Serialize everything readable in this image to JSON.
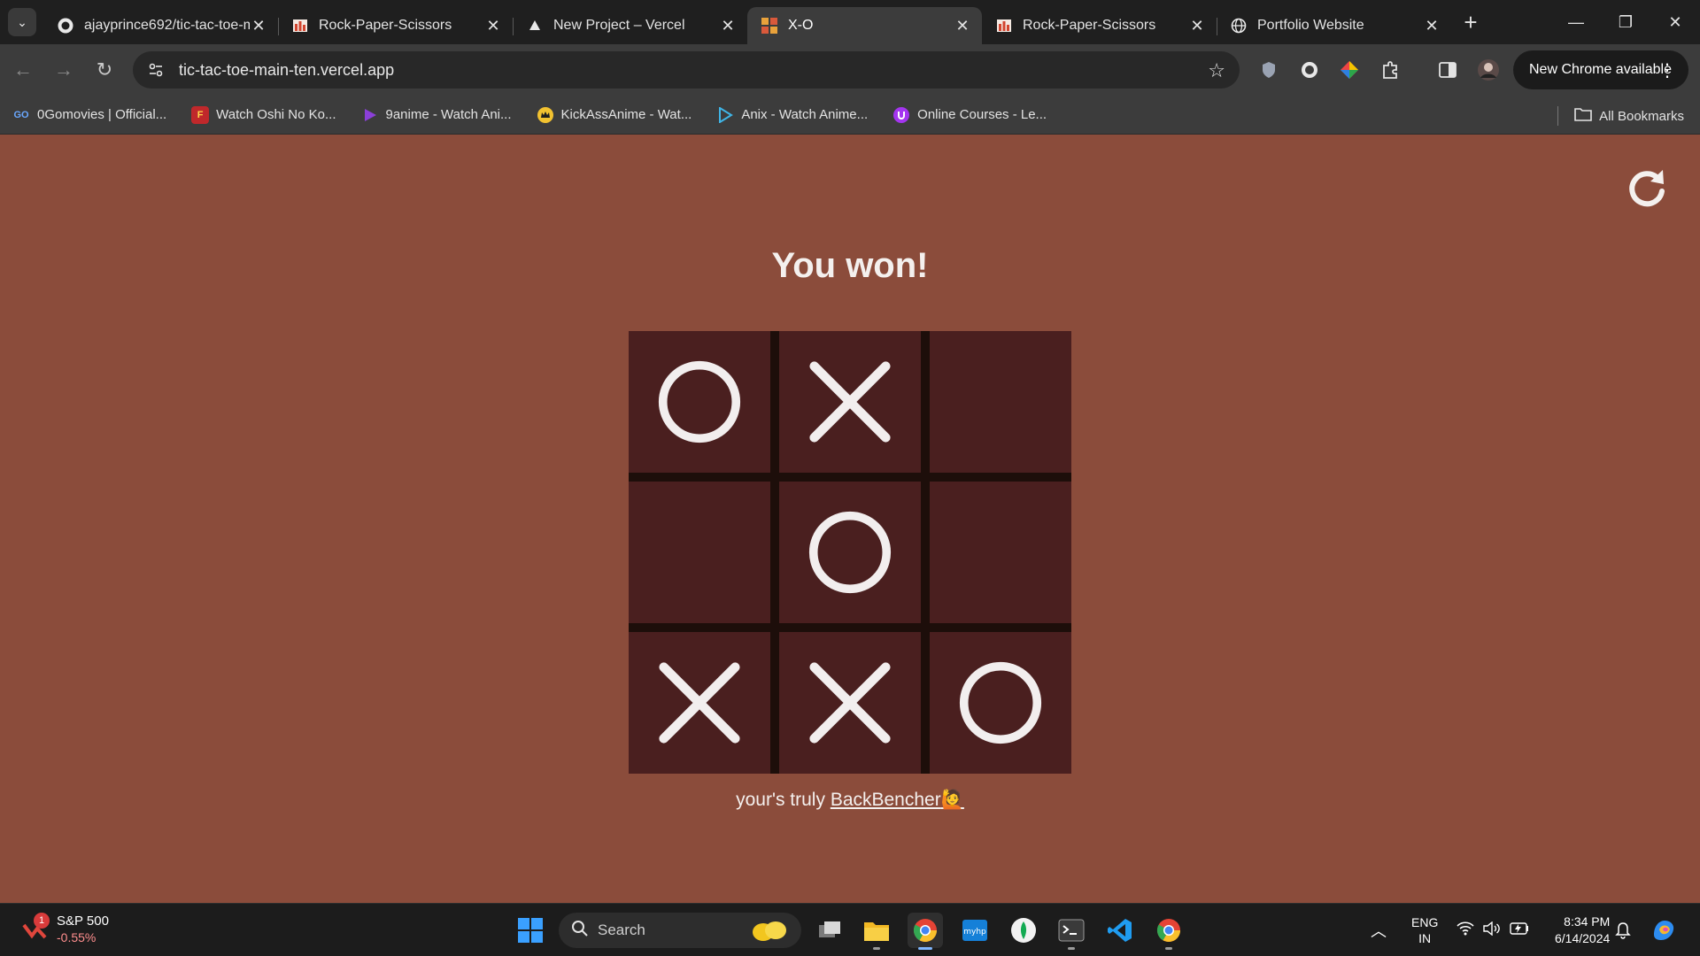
{
  "browser": {
    "tabs": [
      {
        "title": "ajayprince692/tic-tac-toe-main",
        "icon": "github-icon",
        "active": false
      },
      {
        "title": "Rock-Paper-Scissors",
        "icon": "rps-favicon",
        "active": false
      },
      {
        "title": "New Project – Vercel",
        "icon": "vercel-icon",
        "active": false
      },
      {
        "title": "X-O",
        "icon": "xo-favicon",
        "active": true
      },
      {
        "title": "Rock-Paper-Scissors",
        "icon": "rps-favicon",
        "active": false
      },
      {
        "title": "Portfolio Website",
        "icon": "globe-icon",
        "active": false
      }
    ],
    "url": "tic-tac-toe-main-ten.vercel.app",
    "update_button": "New Chrome available",
    "bookmarks": [
      {
        "label": "0Gomovies | Official...",
        "icon": "gomovies-icon"
      },
      {
        "label": "Watch Oshi No Ko...",
        "icon": "oshi-icon"
      },
      {
        "label": "9anime - Watch Ani...",
        "icon": "9anime-icon"
      },
      {
        "label": "KickAssAnime - Wat...",
        "icon": "kickass-icon"
      },
      {
        "label": "Anix - Watch Anime...",
        "icon": "anix-icon"
      },
      {
        "label": "Online Courses - Le...",
        "icon": "udemy-icon"
      }
    ],
    "all_bookmarks": "All Bookmarks"
  },
  "game": {
    "status": "You won!",
    "board": [
      "O",
      "X",
      "",
      "",
      "O",
      "",
      "X",
      "X",
      "O"
    ],
    "footer_prefix": "your's truly ",
    "footer_link": "BackBencher",
    "footer_emoji": "🙋",
    "colors": {
      "page_bg": "#8b4c3b",
      "cell_bg": "#4a1f1f",
      "grid_line": "#1d0e0a",
      "mark": "#f2eeee"
    }
  },
  "taskbar": {
    "widget_title": "S&P 500",
    "widget_value": "-0.55%",
    "widget_badge": "1",
    "search_placeholder": "Search",
    "lang_line1": "ENG",
    "lang_line2": "IN",
    "time": "8:34 PM",
    "date": "6/14/2024"
  }
}
